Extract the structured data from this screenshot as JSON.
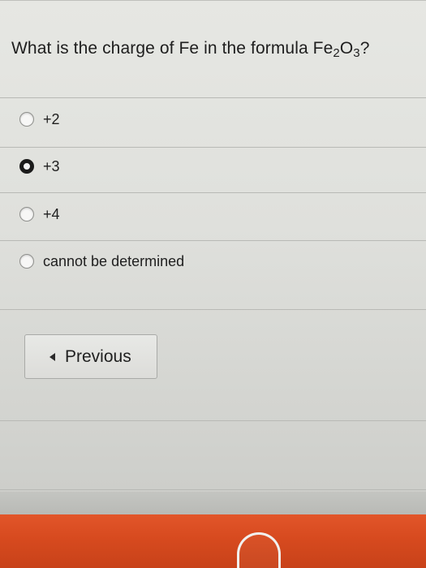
{
  "quiz": {
    "question": {
      "prefix": "What is the charge of Fe in the formula Fe",
      "sub1": "2",
      "mid": "O",
      "sub2": "3",
      "suffix": "?"
    },
    "options": [
      {
        "label": "+2",
        "selected": false
      },
      {
        "label": "+3",
        "selected": true
      },
      {
        "label": "+4",
        "selected": false
      },
      {
        "label": "cannot be determined",
        "selected": false
      }
    ],
    "previous_label": "Previous"
  },
  "icons": {
    "previous": "left-triangle-icon",
    "radio": "radio-button-icon"
  },
  "colors": {
    "page_background": "#e2e3df",
    "bezel": "#d74a1f"
  }
}
